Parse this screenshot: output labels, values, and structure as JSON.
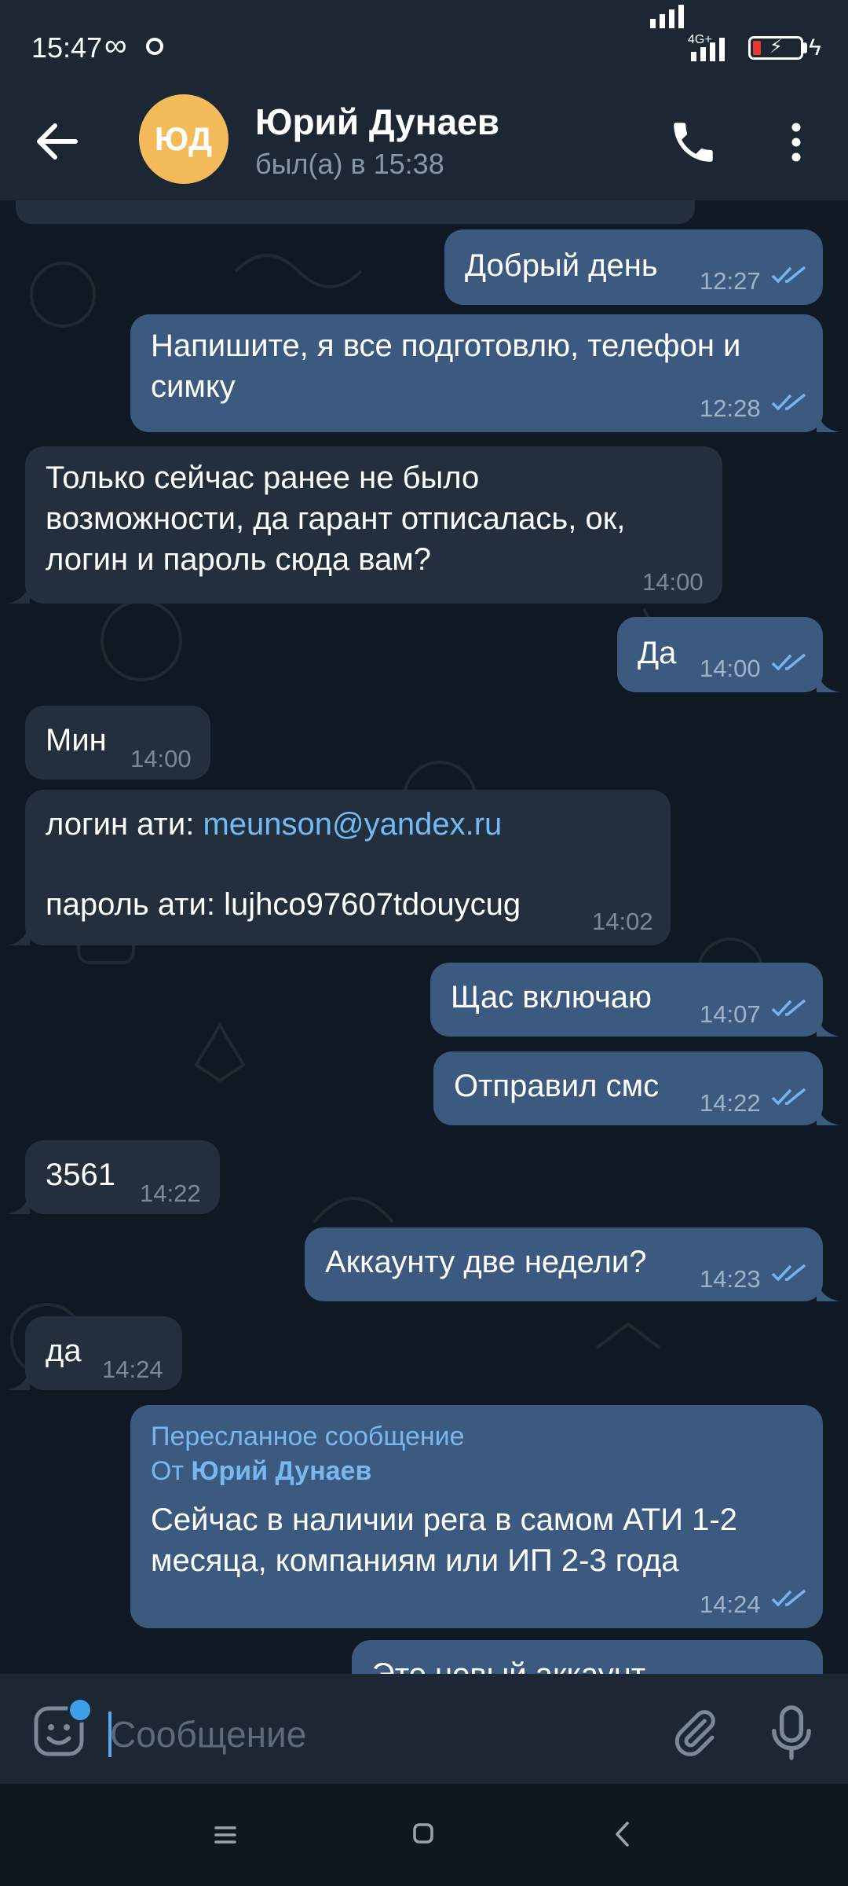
{
  "status_bar": {
    "time": "15:47",
    "infinity_symbol": "∞",
    "network_label": "4G+",
    "battery_level_percent": 15
  },
  "header": {
    "avatar_initials": "ЮД",
    "avatar_color": "#f4bb5a",
    "contact_name": "Юрий Дунаев",
    "contact_status": "был(а) в 15:38",
    "back_icon": "arrow-left-icon",
    "call_icon": "phone-icon",
    "more_icon": "more-vertical-icon"
  },
  "messages": [
    {
      "direction": "out",
      "text": "Добрый день",
      "time": "12:27",
      "read": true
    },
    {
      "direction": "out",
      "text": "Напишите, я все подготовлю, телефон и\nсимку",
      "time": "12:28",
      "read": true
    },
    {
      "direction": "in",
      "text": "Только сейчас ранее не было\nвозможности, да гарант отписалась, ок,\nлогин и пароль сюда вам?",
      "time": "14:00"
    },
    {
      "direction": "out",
      "text": "Да",
      "time": "14:00",
      "read": true
    },
    {
      "direction": "in",
      "text": "Мин",
      "time": "14:00"
    },
    {
      "direction": "in",
      "login_label": "логин ати: ",
      "login_link": "meunson@yandex.ru",
      "password_line": "пароль ати: lujhco97607tdouycug",
      "time": "14:02"
    },
    {
      "direction": "out",
      "text": "Щас включаю",
      "time": "14:07",
      "read": true
    },
    {
      "direction": "out",
      "text": "Отправил смс",
      "time": "14:22",
      "read": true
    },
    {
      "direction": "in",
      "text": "3561",
      "time": "14:22"
    },
    {
      "direction": "out",
      "text": "Аккаунту две недели?",
      "time": "14:23",
      "read": true
    },
    {
      "direction": "in",
      "text": "да",
      "time": "14:24"
    },
    {
      "direction": "out",
      "forwarded_label": "Пересланное сообщение",
      "forwarded_from_prefix": "От ",
      "forwarded_from_name": "Юрий Дунаев",
      "text": "Сейчас в наличии рега в самом АТИ 1-2\nмесяца, компаниям или ИП 2-3 года",
      "time": "14:24",
      "read": true
    },
    {
      "direction": "out",
      "text": "Это новый аккаунт",
      "partial": true
    }
  ],
  "input_bar": {
    "placeholder": "Сообщение",
    "emoji_icon": "sticker-emoji-icon",
    "attach_icon": "paperclip-icon",
    "mic_icon": "microphone-icon"
  },
  "nav_bar": {
    "menu_icon": "recent-apps-icon",
    "home_icon": "home-icon",
    "back_icon": "nav-back-icon"
  },
  "colors": {
    "background": "#0f1923",
    "header": "#1c2733",
    "outgoing_bubble": "#3c5a80",
    "incoming_bubble": "#232f3d",
    "link": "#71baf5",
    "read_ticks": "#72b5f0"
  }
}
